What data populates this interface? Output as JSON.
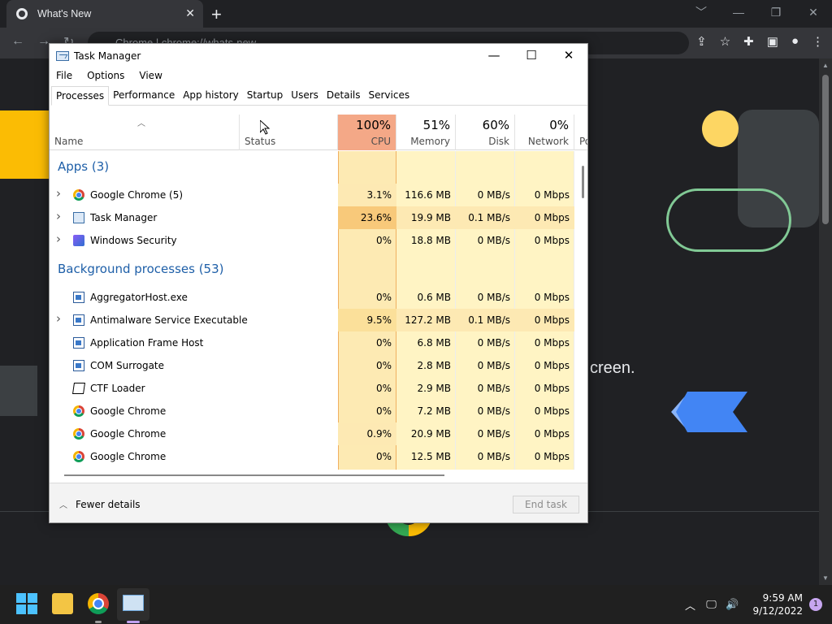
{
  "browser": {
    "tab_title": "What's New",
    "tab_close": "✕",
    "new_tab": "+",
    "window_controls": [
      "﹀",
      "—",
      "❐",
      "✕"
    ],
    "omnibox_text": "Chrome  |  chrome://whats-new"
  },
  "page": {
    "partial_text": "creen."
  },
  "task_manager": {
    "title": "Task Manager",
    "window_controls": {
      "minimize": "—",
      "maximize": "☐",
      "close": "✕"
    },
    "menu": [
      "File",
      "Options",
      "View"
    ],
    "tabs": [
      "Processes",
      "Performance",
      "App history",
      "Startup",
      "Users",
      "Details",
      "Services"
    ],
    "active_tab": "Processes",
    "columns": {
      "name": {
        "label": "Name"
      },
      "status": {
        "label": "Status"
      },
      "cpu": {
        "pct": "100%",
        "label": "CPU"
      },
      "memory": {
        "pct": "51%",
        "label": "Memory"
      },
      "disk": {
        "pct": "60%",
        "label": "Disk"
      },
      "network": {
        "pct": "0%",
        "label": "Network"
      },
      "power": {
        "label": "Po"
      }
    },
    "groups": [
      {
        "heading": "Apps (3)",
        "rows": [
          {
            "name": "Google Chrome (5)",
            "icon": "chrome-icon",
            "expandable": true,
            "cpu": "3.1%",
            "memory": "116.6 MB",
            "disk": "0 MB/s",
            "network": "0 Mbps",
            "heat": "low"
          },
          {
            "name": "Task Manager",
            "icon": "task-manager-icon",
            "expandable": true,
            "cpu": "23.6%",
            "memory": "19.9 MB",
            "disk": "0.1 MB/s",
            "network": "0 Mbps",
            "heat": "high"
          },
          {
            "name": "Windows Security",
            "icon": "windows-security-icon",
            "expandable": true,
            "cpu": "0%",
            "memory": "18.8 MB",
            "disk": "0 MB/s",
            "network": "0 Mbps",
            "heat": "none"
          }
        ]
      },
      {
        "heading": "Background processes (53)",
        "rows": [
          {
            "name": "AggregatorHost.exe",
            "icon": "exe-icon",
            "expandable": false,
            "cpu": "0%",
            "memory": "0.6 MB",
            "disk": "0 MB/s",
            "network": "0 Mbps",
            "heat": "none"
          },
          {
            "name": "Antimalware Service Executable",
            "icon": "exe-icon",
            "expandable": true,
            "cpu": "9.5%",
            "memory": "127.2 MB",
            "disk": "0.1 MB/s",
            "network": "0 Mbps",
            "heat": "mid"
          },
          {
            "name": "Application Frame Host",
            "icon": "exe-icon",
            "expandable": false,
            "cpu": "0%",
            "memory": "6.8 MB",
            "disk": "0 MB/s",
            "network": "0 Mbps",
            "heat": "none"
          },
          {
            "name": "COM Surrogate",
            "icon": "exe-icon",
            "expandable": false,
            "cpu": "0%",
            "memory": "2.8 MB",
            "disk": "0 MB/s",
            "network": "0 Mbps",
            "heat": "none"
          },
          {
            "name": "CTF Loader",
            "icon": "ctf-loader-icon",
            "expandable": false,
            "cpu": "0%",
            "memory": "2.9 MB",
            "disk": "0 MB/s",
            "network": "0 Mbps",
            "heat": "none"
          },
          {
            "name": "Google Chrome",
            "icon": "chrome-icon",
            "expandable": false,
            "cpu": "0%",
            "memory": "7.2 MB",
            "disk": "0 MB/s",
            "network": "0 Mbps",
            "heat": "none"
          },
          {
            "name": "Google Chrome",
            "icon": "chrome-icon",
            "expandable": false,
            "cpu": "0.9%",
            "memory": "20.9 MB",
            "disk": "0 MB/s",
            "network": "0 Mbps",
            "heat": "low"
          },
          {
            "name": "Google Chrome",
            "icon": "chrome-icon",
            "expandable": false,
            "cpu": "0%",
            "memory": "12.5 MB",
            "disk": "0 MB/s",
            "network": "0 Mbps",
            "heat": "none"
          }
        ]
      }
    ],
    "footer": {
      "fewer_details": "Fewer details",
      "end_task": "End task"
    }
  },
  "taskbar": {
    "time": "9:59 AM",
    "date": "9/12/2022",
    "notification_count": "1",
    "tray_icons": [
      "chevron-up-icon",
      "network-icon",
      "volume-icon"
    ]
  },
  "colors": {
    "cpu_header": "#f4a887",
    "group_heading": "#1e5fa8",
    "accent": "#4cc2ff"
  }
}
